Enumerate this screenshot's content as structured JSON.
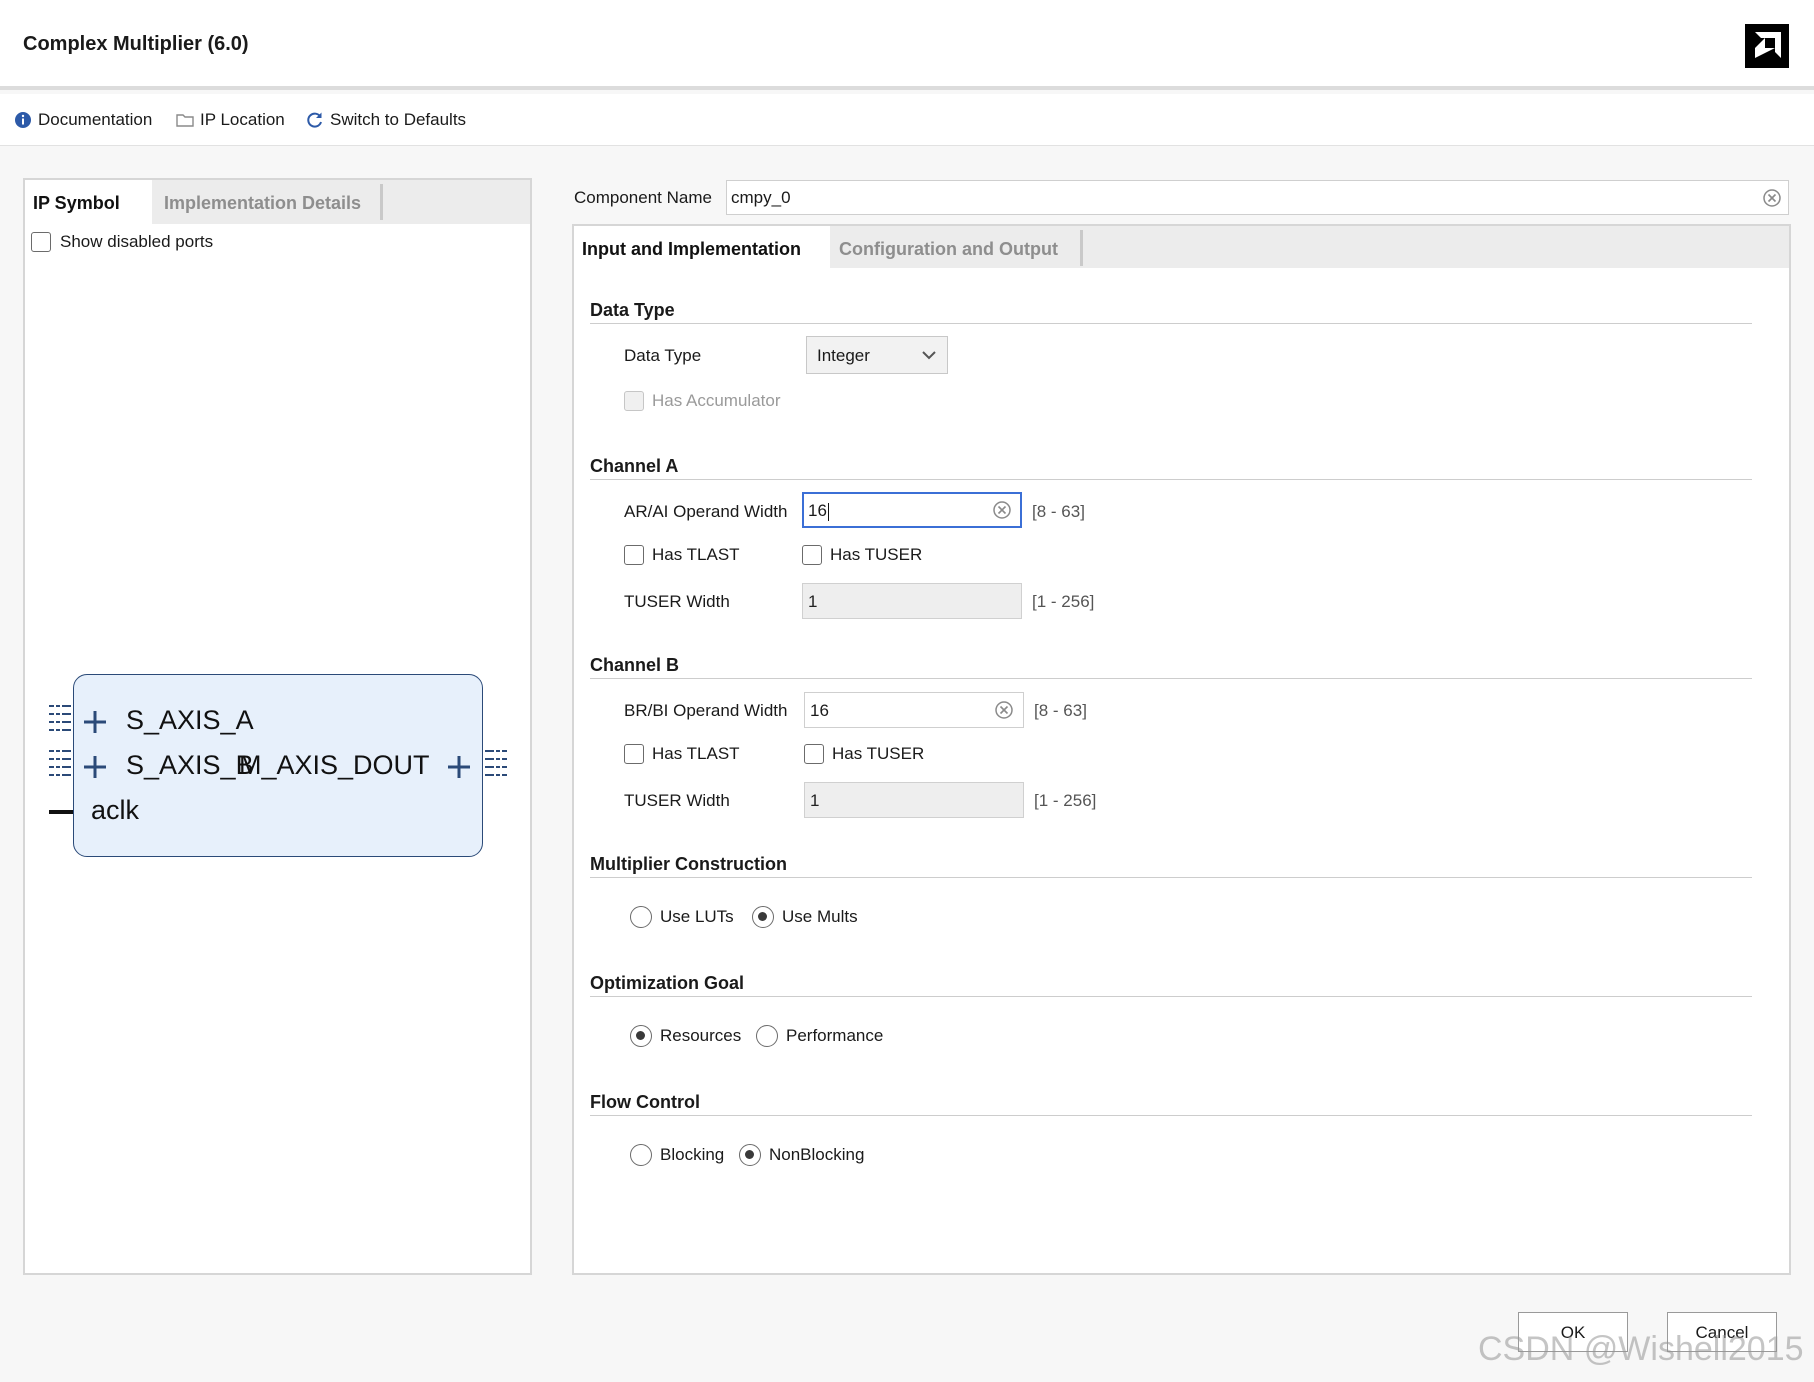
{
  "window": {
    "title": "Complex Multiplier (6.0)",
    "logo_icon": "amd-logo"
  },
  "toolbar": {
    "documentation": "Documentation",
    "ip_location": "IP Location",
    "switch_defaults": "Switch to Defaults"
  },
  "left": {
    "tabs": [
      "IP Symbol",
      "Implementation Details"
    ],
    "active_tab": 0,
    "show_disabled_ports": "Show disabled ports",
    "show_disabled_checked": false,
    "ports": {
      "s_axis_a": "S_AXIS_A",
      "s_axis_b": "S_AXIS_B",
      "m_axis_dout": "M_AXIS_DOUT",
      "aclk": "aclk"
    }
  },
  "component": {
    "label": "Component Name",
    "value": "cmpy_0"
  },
  "right": {
    "tabs": [
      "Input and Implementation",
      "Configuration and Output"
    ],
    "active_tab": 0,
    "data_type": {
      "section": "Data Type",
      "label": "Data Type",
      "value": "Integer",
      "has_accumulator": "Has Accumulator"
    },
    "channel_a": {
      "section": "Channel A",
      "operand_label": "AR/AI Operand Width",
      "operand_value": "16",
      "operand_range": "[8 - 63]",
      "has_tlast": "Has TLAST",
      "has_tuser": "Has TUSER",
      "tuser_label": "TUSER Width",
      "tuser_value": "1",
      "tuser_range": "[1 - 256]"
    },
    "channel_b": {
      "section": "Channel B",
      "operand_label": "BR/BI Operand Width",
      "operand_value": "16",
      "operand_range": "[8 - 63]",
      "has_tlast": "Has TLAST",
      "has_tuser": "Has TUSER",
      "tuser_label": "TUSER Width",
      "tuser_value": "1",
      "tuser_range": "[1 - 256]"
    },
    "multiplier": {
      "section": "Multiplier Construction",
      "options": [
        "Use LUTs",
        "Use Mults"
      ],
      "selected": "Use Mults"
    },
    "optimization": {
      "section": "Optimization Goal",
      "options": [
        "Resources",
        "Performance"
      ],
      "selected": "Resources"
    },
    "flow": {
      "section": "Flow Control",
      "options": [
        "Blocking",
        "NonBlocking"
      ],
      "selected": "NonBlocking"
    }
  },
  "buttons": {
    "ok": "OK",
    "cancel": "Cancel"
  },
  "watermark": "CSDN @Wishell2015",
  "colors": {
    "focus_border": "#3b6fd6",
    "symbol_fill": "#e7f0fb",
    "symbol_stroke": "#2b4a78"
  }
}
